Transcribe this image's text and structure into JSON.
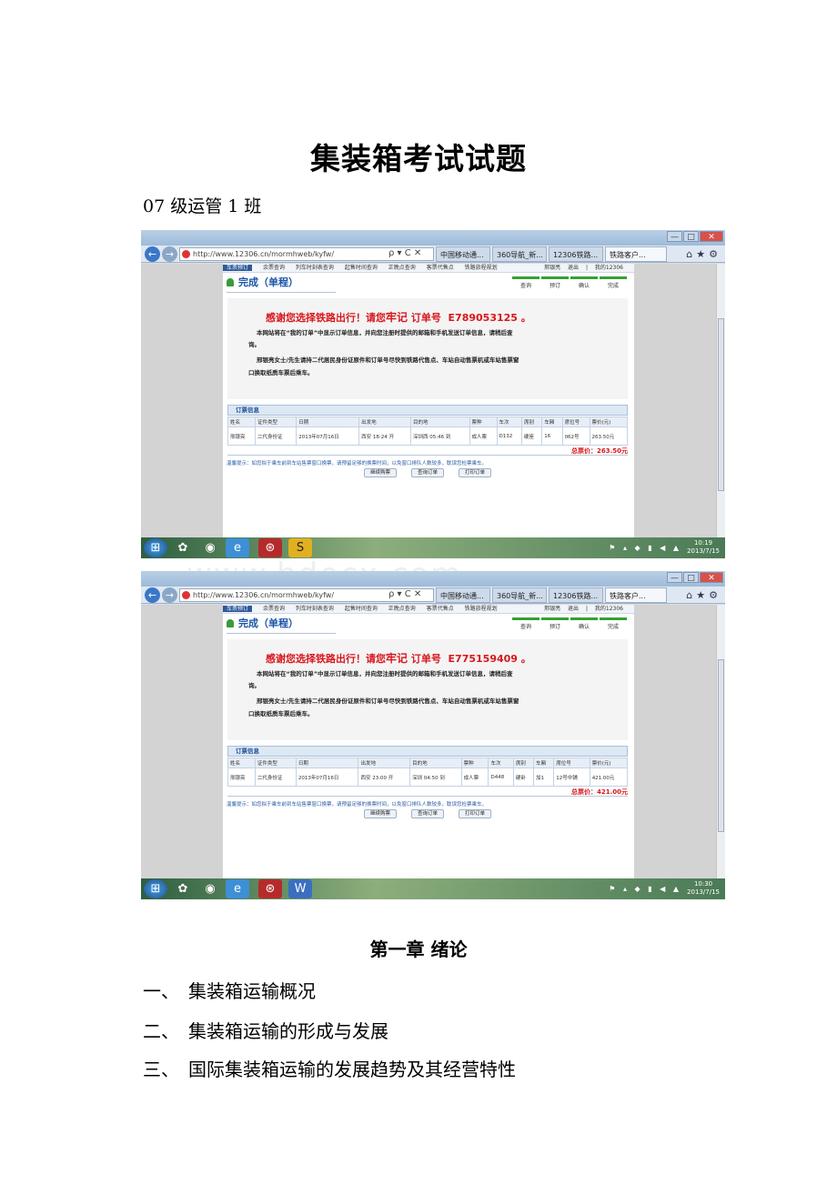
{
  "doc": {
    "title": "集装箱考试试题",
    "subtitle": "07 级运管 1 班",
    "watermark": "www.bdocx.com"
  },
  "browser_common": {
    "url": "http://www.12306.cn/mormhweb/kyfw/",
    "address_tools": "ρ ▾ C ✕",
    "tabs": [
      "中国移动通...",
      "360导航_新...",
      "12306铁路...",
      "铁路客户..."
    ],
    "toolbar_icons": "⌂★⚙",
    "window_controls": [
      "—",
      "□",
      "✕"
    ],
    "menu": [
      "车票预订",
      "余票查询",
      "列车时刻表查询",
      "起售时间查询",
      "正晚点查询",
      "客票代售点",
      "铁路旅程规划"
    ],
    "menu_right": [
      "邢银亮",
      "退出",
      "|",
      "我的12306"
    ],
    "page_heading": "完成（单程）",
    "steps": [
      "查询",
      "预订",
      "确认",
      "完成"
    ],
    "thanks_prefix": "感谢您选择铁路出行！请您",
    "thanks_big": "牢记",
    "thanks_mid": "订单号",
    "line1": "本网站将在“我的订单”中显示订单信息，并向您注册时提供的邮箱和手机发送订单信息，请稍后查",
    "line2": "询。",
    "line3": "邢银亮女士/先生请持二代居民身份证原件和订单号尽快到铁路代售点、车站自动售票机或车站售票窗",
    "line4": "口换取纸质车票后乘车。",
    "info_head": "订票信息",
    "columns": [
      "姓名",
      "证件类型",
      "日期",
      "出发地",
      "目的地",
      "票种",
      "车次",
      "席别",
      "车厢",
      "席位号",
      "票价(元)"
    ],
    "tip": "温馨提示：如您拟于乘车前到车站售票窗口换票，请预留足够的换票时间，以免窗口排队人数较多，耽误您检票乘车。",
    "buttons": [
      "继续购票",
      "查询订单",
      "打印订单"
    ]
  },
  "screenshot1": {
    "order_no": "E789053125",
    "row": [
      "邢银亮",
      "二代身份证",
      "2013年07月16日",
      "西安 18:24 开",
      "深圳西 05:46 到",
      "成人票",
      "D132",
      "硬座",
      "16",
      "062号",
      "263.50元"
    ],
    "total": "总票价：263.50元",
    "clock_time": "10:19",
    "clock_date": "2013/7/15"
  },
  "screenshot2": {
    "order_no": "E775159409",
    "row": [
      "邢银亮",
      "二代身份证",
      "2013年07月16日",
      "西安 23:00 开",
      "深圳 04:50 到",
      "成人票",
      "D448",
      "硬卧",
      "加1",
      "12号中铺",
      "421.00元"
    ],
    "total": "总票价：421.00元",
    "clock_time": "10:30",
    "clock_date": "2013/7/15"
  },
  "chapter": {
    "title": "第一章 绪论",
    "items": [
      {
        "num": "一、",
        "text": "集装箱运输概况"
      },
      {
        "num": "二、",
        "text": "集装箱运输的形成与发展"
      },
      {
        "num": "三、",
        "text": "国际集装箱运输的发展趋势及其经营特性"
      }
    ]
  },
  "colors": {
    "accent_red": "#d8171c",
    "brand_blue": "#1a54a8",
    "step_green": "#35a035"
  }
}
